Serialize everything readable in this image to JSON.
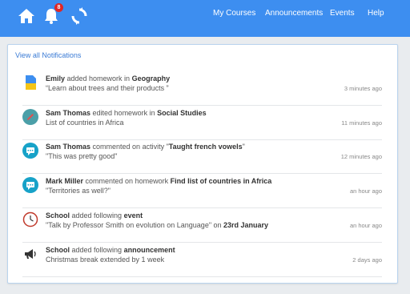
{
  "nav": {
    "badge_count": "8",
    "links": [
      "My Courses",
      "Announcements",
      "Events",
      "Help"
    ]
  },
  "panel": {
    "view_all": "View all Notifications"
  },
  "notifications": [
    {
      "icon": "document-icon",
      "actor": "Emily",
      "verb": " added homework in ",
      "target": "Geography",
      "detail": "“Learn about trees and their products ”",
      "time": "3 minutes ago"
    },
    {
      "icon": "pencil-icon",
      "actor": "Sam Thomas",
      "verb": " edited homework in ",
      "target": "Social Studies",
      "detail": "List of countries in Africa",
      "time": "11 minutes ago"
    },
    {
      "icon": "comment-icon",
      "actor": "Sam Thomas",
      "verb": " commented on activity \"",
      "target": "Taught french vowels",
      "suffix": "\"",
      "detail": "\"This was pretty good\"",
      "time": "12 minutes ago"
    },
    {
      "icon": "comment-icon",
      "actor": "Mark Miller",
      "verb": " commented on homework ",
      "target": "Find list of countries in Africa",
      "detail": "\"Territories as well?\"",
      "time": "an hour ago"
    },
    {
      "icon": "clock-icon",
      "actor": "School",
      "verb": " added following ",
      "target": "event",
      "detail": "\"Talk by Professor Smith on evolution on Language\" on ",
      "detail_bold": "23rd January",
      "time": "an hour ago"
    },
    {
      "icon": "megaphone-icon",
      "actor": "School",
      "verb": " added following ",
      "target": "announcement",
      "detail": "Christmas break extended by 1 week",
      "time": "2 days ago"
    }
  ],
  "colors": {
    "topbar": "#3d8ef0",
    "link": "#3a7bd5",
    "badge": "#e02626",
    "icon_teal": "#17a2c8"
  }
}
